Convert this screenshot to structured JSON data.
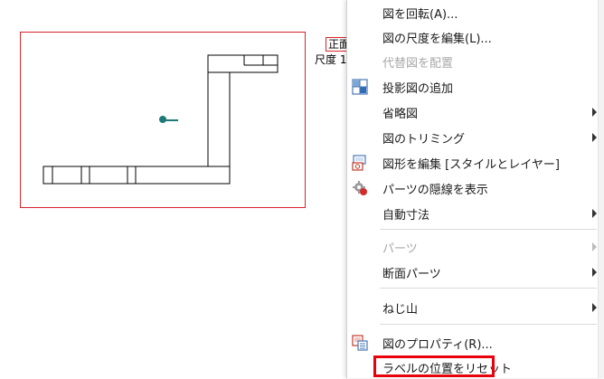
{
  "drawing": {
    "view_label": "正面",
    "scale_label": "尺度 1"
  },
  "context_menu": {
    "items": [
      {
        "label": "図を回転(A)...",
        "enabled": true,
        "submenu": false,
        "icon": ""
      },
      {
        "label": "図の尺度を編集(L)...",
        "enabled": true,
        "submenu": false,
        "icon": ""
      },
      {
        "label": "代替図を配置",
        "enabled": false,
        "submenu": false,
        "icon": ""
      },
      {
        "label": "投影図の追加",
        "enabled": true,
        "submenu": false,
        "icon": "projected-view-icon"
      },
      {
        "label": "省略図",
        "enabled": true,
        "submenu": true,
        "icon": ""
      },
      {
        "label": "図のトリミング",
        "enabled": true,
        "submenu": true,
        "icon": ""
      },
      {
        "label": "図形を編集 [スタイルとレイヤー]",
        "enabled": true,
        "submenu": false,
        "icon": "edit-view-icon"
      },
      {
        "label": "パーツの隠線を表示",
        "enabled": true,
        "submenu": false,
        "icon": "hidden-lines-gear-icon"
      },
      {
        "label": "自動寸法",
        "enabled": true,
        "submenu": true,
        "icon": ""
      },
      {
        "label": "パーツ",
        "enabled": false,
        "submenu": true,
        "icon": ""
      },
      {
        "label": "断面パーツ",
        "enabled": true,
        "submenu": true,
        "icon": ""
      },
      {
        "label": "ねじ山",
        "enabled": true,
        "submenu": true,
        "icon": ""
      },
      {
        "label": "図のプロパティ(R)...",
        "enabled": true,
        "submenu": false,
        "icon": "view-properties-icon"
      },
      {
        "label": "ラベルの位置をリセット",
        "enabled": true,
        "submenu": false,
        "icon": "",
        "highlighted": true
      }
    ]
  },
  "colors": {
    "frame_red": "#d9232a",
    "highlight_red": "#e8000b",
    "disabled_text": "#a8a8a8",
    "teal_marker": "#1e7a78"
  }
}
